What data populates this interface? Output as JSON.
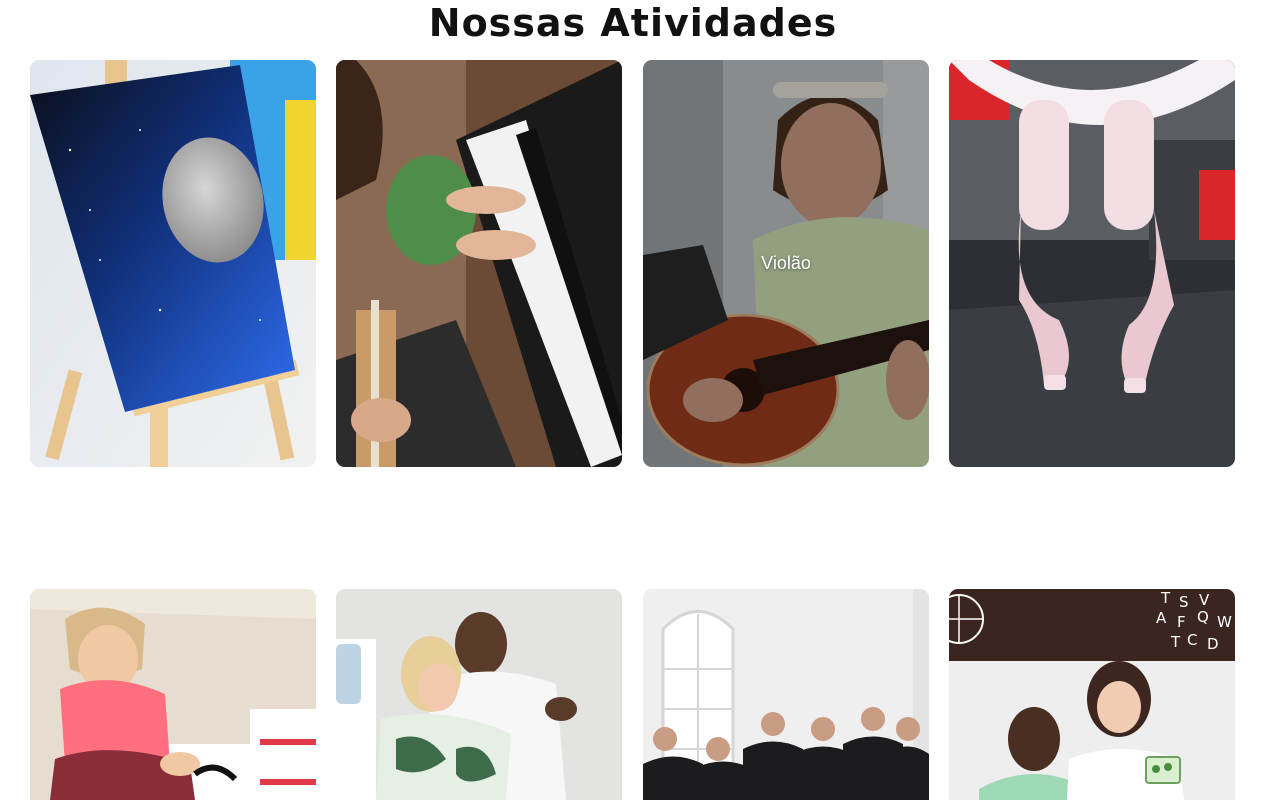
{
  "section": {
    "title": "Nossas Atividades"
  },
  "activities": [
    {
      "label": "",
      "image": "painting-canvas-moon",
      "hovered": false
    },
    {
      "label": "",
      "image": "piano-hands",
      "hovered": false
    },
    {
      "label": "Violão",
      "image": "girl-playing-guitar",
      "hovered": true
    },
    {
      "label": "",
      "image": "ballet-pointe-shoes",
      "hovered": false
    },
    {
      "label": "",
      "image": "child-drawing-on-floor",
      "hovered": false
    },
    {
      "label": "",
      "image": "couple-dancing",
      "hovered": false
    },
    {
      "label": "",
      "image": "choir-singing",
      "hovered": false
    },
    {
      "label": "",
      "image": "teacher-with-child-flashcards",
      "hovered": false
    }
  ],
  "colors": {
    "title": "#111111",
    "background": "#ffffff",
    "overlay": "rgba(0,0,0,0.32)"
  }
}
